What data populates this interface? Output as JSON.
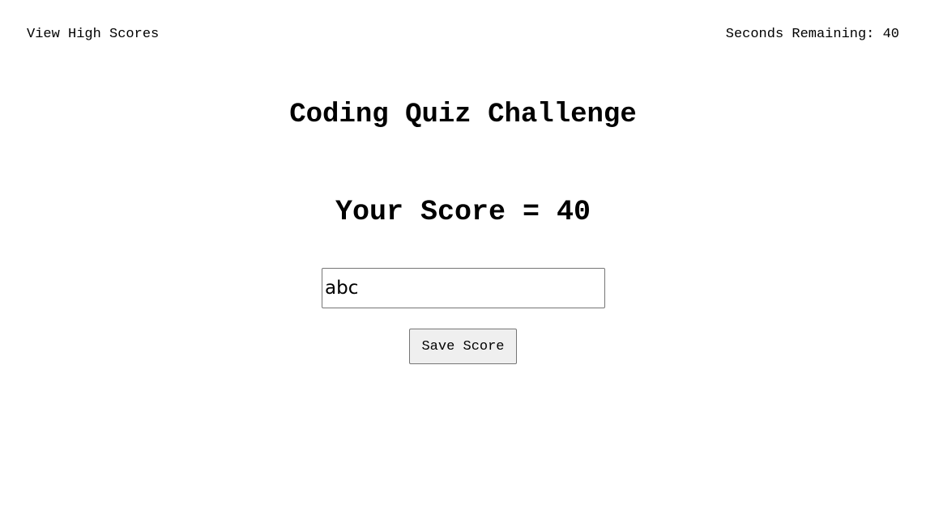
{
  "header": {
    "high_scores_link": "View High Scores",
    "timer_label": "Seconds Remaining:",
    "timer_value": "40"
  },
  "main": {
    "title": "Coding Quiz Challenge",
    "score_label": "Your Score =",
    "score_value": "40"
  },
  "form": {
    "initials_value": "abc",
    "save_button_label": "Save Score"
  }
}
